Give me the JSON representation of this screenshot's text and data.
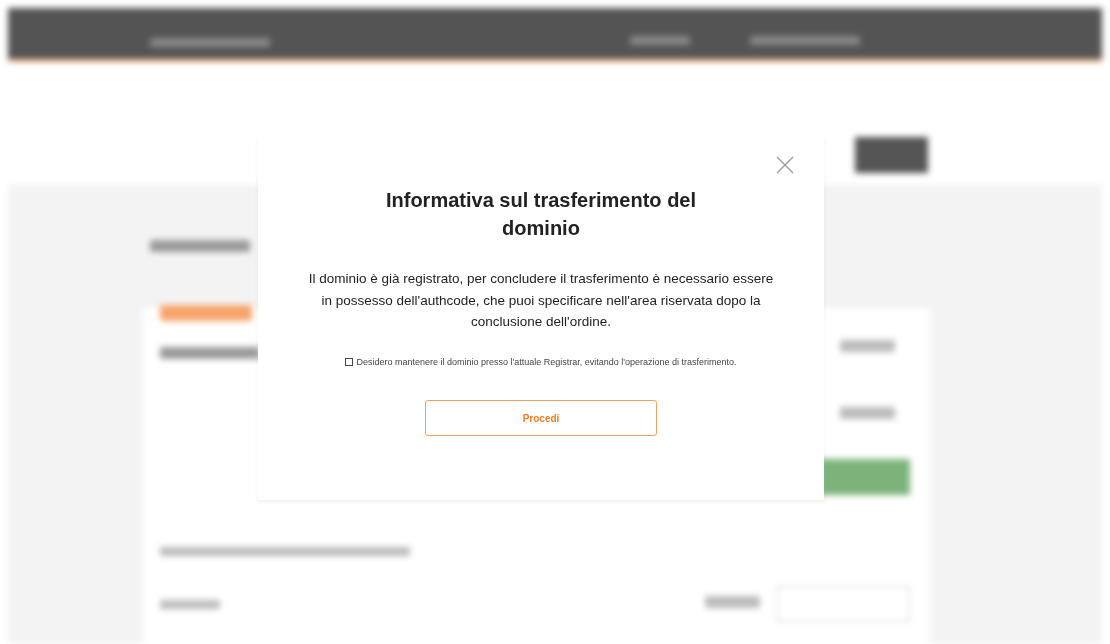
{
  "modal": {
    "title": "Informativa sul trasferimento del dominio",
    "message": "Il dominio è già registrato, per concludere il trasferimento è necessario essere in possesso dell'authcode, che puoi specificare nell'area riservata dopo la conclusione dell'ordine.",
    "checkbox": {
      "label": "Desidero mantenere il dominio presso l'attuale Registrar, evitando l'operazione di trasferimento.",
      "checked": false
    },
    "button": "Procedi"
  }
}
